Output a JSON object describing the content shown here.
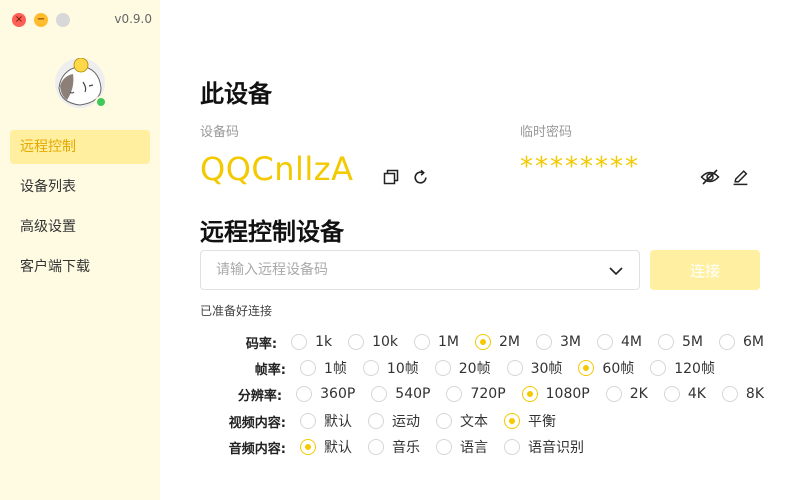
{
  "app": {
    "version": "v0.9.0"
  },
  "sidebar": {
    "items": [
      {
        "label": "远程控制",
        "active": true
      },
      {
        "label": "设备列表",
        "active": false
      },
      {
        "label": "高级设置",
        "active": false
      },
      {
        "label": "客户端下载",
        "active": false
      }
    ]
  },
  "this_device": {
    "title": "此设备",
    "device_code_label": "设备码",
    "device_code": "QQCnllzA",
    "temp_password_label": "临时密码",
    "temp_password": "********"
  },
  "remote": {
    "title": "远程控制设备",
    "input_placeholder": "请输入远程设备码",
    "input_value": "",
    "connect_label": "连接",
    "status": "已准备好连接"
  },
  "settings": [
    {
      "label": "码率:",
      "options": [
        "1k",
        "10k",
        "1M",
        "2M",
        "3M",
        "4M",
        "5M",
        "6M"
      ],
      "selected": 3
    },
    {
      "label": "帧率:",
      "options": [
        "1帧",
        "10帧",
        "20帧",
        "30帧",
        "60帧",
        "120帧"
      ],
      "selected": 4
    },
    {
      "label": "分辨率:",
      "options": [
        "360P",
        "540P",
        "720P",
        "1080P",
        "2K",
        "4K",
        "8K"
      ],
      "selected": 3
    },
    {
      "label": "视频内容:",
      "options": [
        "默认",
        "运动",
        "文本",
        "平衡"
      ],
      "selected": 3
    },
    {
      "label": "音频内容:",
      "options": [
        "默认",
        "音乐",
        "语言",
        "语音识别"
      ],
      "selected": 0
    }
  ],
  "colors": {
    "accent": "#f3c900",
    "sidebar_bg": "#fffbe3",
    "active_bg": "#ffef9e",
    "online": "#41c85a"
  },
  "icons": [
    "close-icon",
    "minimize-icon",
    "copy-icon",
    "refresh-icon",
    "eye-off-icon",
    "edit-icon",
    "chevron-down-icon"
  ]
}
